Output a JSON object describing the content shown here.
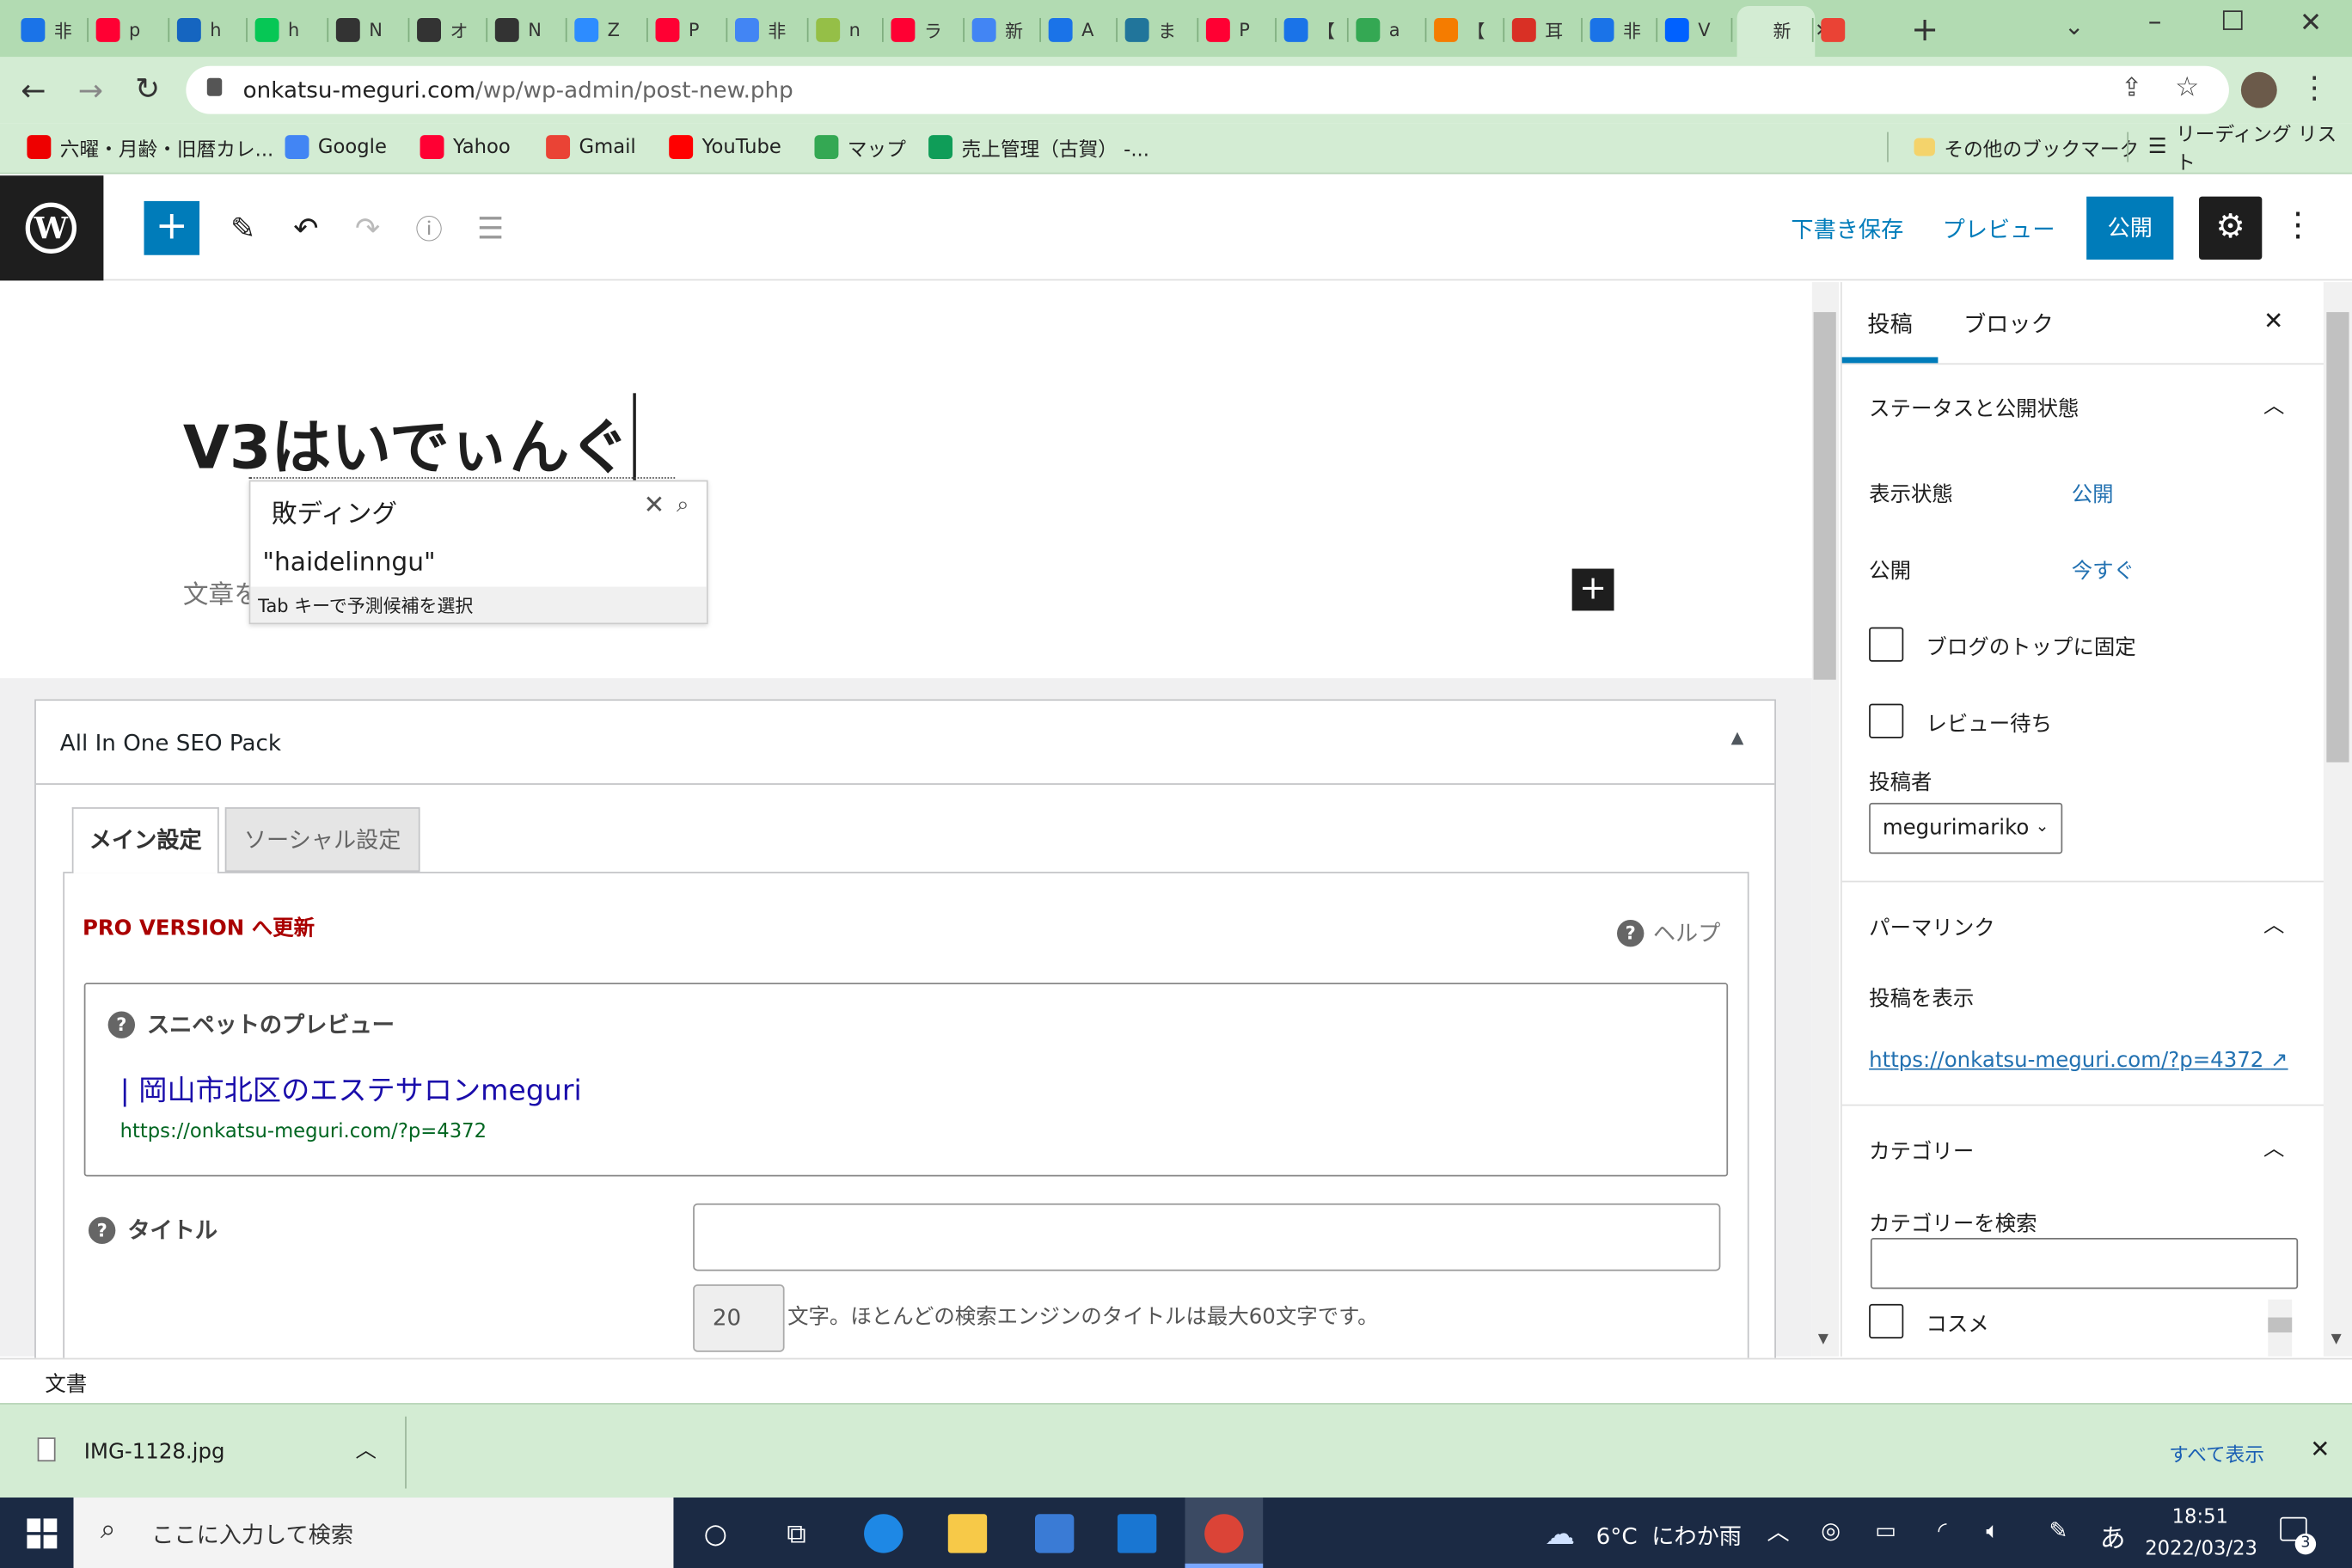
{
  "browser": {
    "tabs": [
      {
        "label": "非",
        "icon": "triangle-drive-icon",
        "color": "#1a73e8"
      },
      {
        "label": "p",
        "icon": "yahoo-icon",
        "color": "#ff0033"
      },
      {
        "label": "h",
        "icon": "b-icon",
        "color": "#1565c0"
      },
      {
        "label": "h",
        "icon": "line-icon",
        "color": "#06c755"
      },
      {
        "label": "N",
        "icon": "globe-icon",
        "color": "#333"
      },
      {
        "label": "オ",
        "icon": "globe-icon",
        "color": "#333"
      },
      {
        "label": "N",
        "icon": "globe-icon",
        "color": "#333"
      },
      {
        "label": "Z",
        "icon": "zoom-icon",
        "color": "#2d8cff"
      },
      {
        "label": "P",
        "icon": "paypay-icon",
        "color": "#ff0033"
      },
      {
        "label": "非",
        "icon": "arrow-icon",
        "color": "#4285f4"
      },
      {
        "label": "n",
        "icon": "shopify-icon",
        "color": "#95bf47"
      },
      {
        "label": "ラ",
        "icon": "yahoo-icon",
        "color": "#ff0033"
      },
      {
        "label": "新",
        "icon": "arrow-icon",
        "color": "#4285f4"
      },
      {
        "label": "A",
        "icon": "triangle-drive-icon",
        "color": "#1a73e8"
      },
      {
        "label": "ま",
        "icon": "wordpress-icon",
        "color": "#21759b"
      },
      {
        "label": "P",
        "icon": "paypay-icon",
        "color": "#ff0033"
      },
      {
        "label": "【",
        "icon": "triangle-drive-icon",
        "color": "#1a73e8"
      },
      {
        "label": "a",
        "icon": "calendar-icon",
        "color": "#34a853"
      },
      {
        "label": "【",
        "icon": "orange-icon",
        "color": "#f57c00"
      },
      {
        "label": "耳",
        "icon": "ticket-icon",
        "color": "#d93025"
      },
      {
        "label": "非",
        "icon": "triangle-drive-icon",
        "color": "#1a73e8"
      },
      {
        "label": "V",
        "icon": "dropbox-icon",
        "color": "#0061ff"
      },
      {
        "label": "新",
        "icon": "active",
        "color": "#333"
      },
      {
        "label": "",
        "icon": "gmail-icon",
        "color": "#ea4335"
      }
    ],
    "url_host": "onkatsu-meguri.com",
    "url_path": "/wp/wp-admin/post-new.php",
    "bookmarks": [
      {
        "label": "六曜・月齢・旧暦カレ...",
        "icon": "acrobat-icon"
      },
      {
        "label": "Google",
        "icon": "google-icon"
      },
      {
        "label": "Yahoo",
        "icon": "yahoo-icon"
      },
      {
        "label": "Gmail",
        "icon": "gmail-icon"
      },
      {
        "label": "YouTube",
        "icon": "youtube-icon"
      },
      {
        "label": "マップ",
        "icon": "maps-icon"
      },
      {
        "label": "売上管理（古賀） -...",
        "icon": "sheets-icon"
      }
    ],
    "other_bookmarks": "その他のブックマーク",
    "reading_list": "リーディング リスト"
  },
  "wp_toolbar": {
    "save_draft": "下書き保存",
    "preview": "プレビュー",
    "publish": "公開"
  },
  "editor": {
    "title": "V3はいでぃんぐ",
    "ime_input": "敗ディング",
    "ime_candidate": "\"haidelinngu\"",
    "ime_hint": "Tab キーで予測候補を選択",
    "body_placeholder": "文章を"
  },
  "seo": {
    "header": "All In One SEO Pack",
    "tab_main": "メイン設定",
    "tab_social": "ソーシャル設定",
    "pro_link": "PRO VERSION へ更新",
    "help": "ヘルプ",
    "snippet_label": "スニペットのプレビュー",
    "snippet_title": "| 岡山市北区のエステサロンmeguri",
    "snippet_url": "https://onkatsu-meguri.com/?p=4372",
    "title_label": "タイトル",
    "title_value": "",
    "char_count": "20",
    "char_note": "文字。ほとんどの検索エンジンのタイトルは最大60文字です。"
  },
  "sidebar": {
    "tab_post": "投稿",
    "tab_block": "ブロック",
    "status_header": "ステータスと公開状態",
    "visibility_label": "表示状態",
    "visibility_value": "公開",
    "publish_label": "公開",
    "publish_value": "今すぐ",
    "sticky_label": "ブログのトップに固定",
    "pending_label": "レビュー待ち",
    "author_label": "投稿者",
    "author_value": "megurimariko",
    "permalink_header": "パーマリンク",
    "view_post": "投稿を表示",
    "permalink_url": "https://onkatsu-meguri.com/?p=4372",
    "category_header": "カテゴリー",
    "category_search_label": "カテゴリーを検索",
    "category_1": "コスメ"
  },
  "status": {
    "breadcrumb": "文書"
  },
  "download": {
    "filename": "IMG-1128.jpg",
    "show_all": "すべて表示"
  },
  "taskbar": {
    "search_placeholder": "ここに入力して検索",
    "weather": "6°C  にわか雨",
    "ime": "あ",
    "time": "18:51",
    "date": "2022/03/23",
    "notif_count": "3"
  }
}
